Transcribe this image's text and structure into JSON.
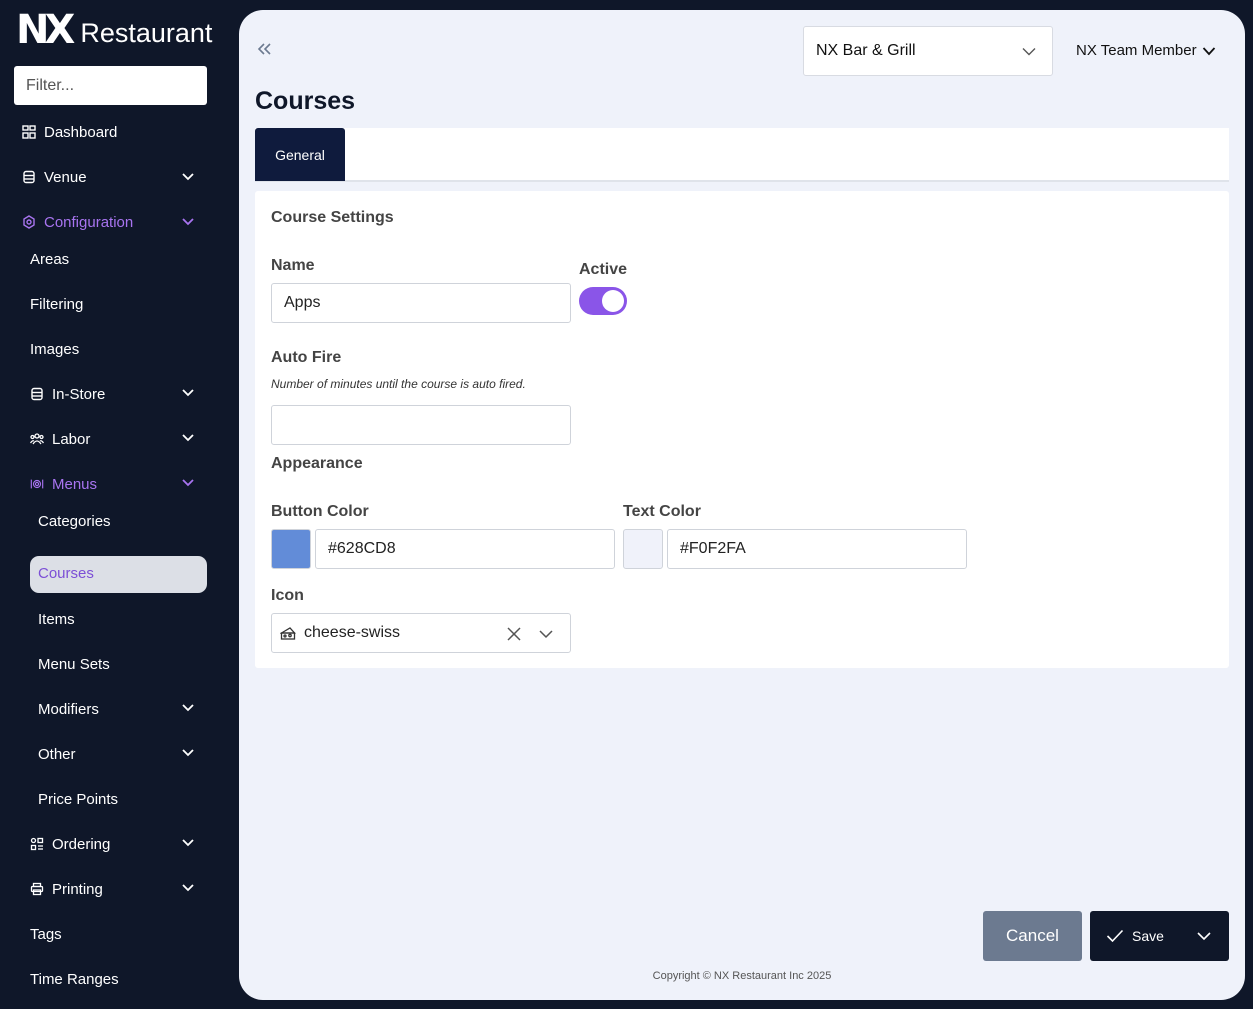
{
  "brand": {
    "mark": "NX",
    "name": "Restaurant"
  },
  "sidebar": {
    "filter_placeholder": "Filter...",
    "items": [
      {
        "label": "Dashboard"
      },
      {
        "label": "Venue"
      },
      {
        "label": "Configuration"
      },
      {
        "label": "Areas"
      },
      {
        "label": "Filtering"
      },
      {
        "label": "Images"
      },
      {
        "label": "In-Store"
      },
      {
        "label": "Labor"
      },
      {
        "label": "Menus"
      },
      {
        "label": "Categories"
      },
      {
        "label": "Courses"
      },
      {
        "label": "Items"
      },
      {
        "label": "Menu Sets"
      },
      {
        "label": "Modifiers"
      },
      {
        "label": "Other"
      },
      {
        "label": "Price Points"
      },
      {
        "label": "Ordering"
      },
      {
        "label": "Printing"
      },
      {
        "label": "Tags"
      },
      {
        "label": "Time Ranges"
      }
    ]
  },
  "header": {
    "venue": "NX Bar & Grill",
    "user": "NX Team Member"
  },
  "page": {
    "title": "Courses",
    "tab": "General"
  },
  "form": {
    "section_title": "Course Settings",
    "name_label": "Name",
    "name_value": "Apps",
    "active_label": "Active",
    "active": true,
    "auto_fire_label": "Auto Fire",
    "auto_fire_hint": "Number of minutes until the course is auto fired.",
    "auto_fire_value": "",
    "appearance_label": "Appearance",
    "button_color_label": "Button Color",
    "button_color": "#628CD8",
    "text_color_label": "Text Color",
    "text_color": "#F0F2FA",
    "icon_label": "Icon",
    "icon_value": "cheese-swiss"
  },
  "actions": {
    "cancel": "Cancel",
    "save": "Save"
  },
  "footer": {
    "copyright": "Copyright © NX Restaurant Inc 2025"
  },
  "colors": {
    "sidebar_bg": "#0F1729",
    "accent": "#8A55E8",
    "tab_active_bg": "#0F1B3D"
  }
}
